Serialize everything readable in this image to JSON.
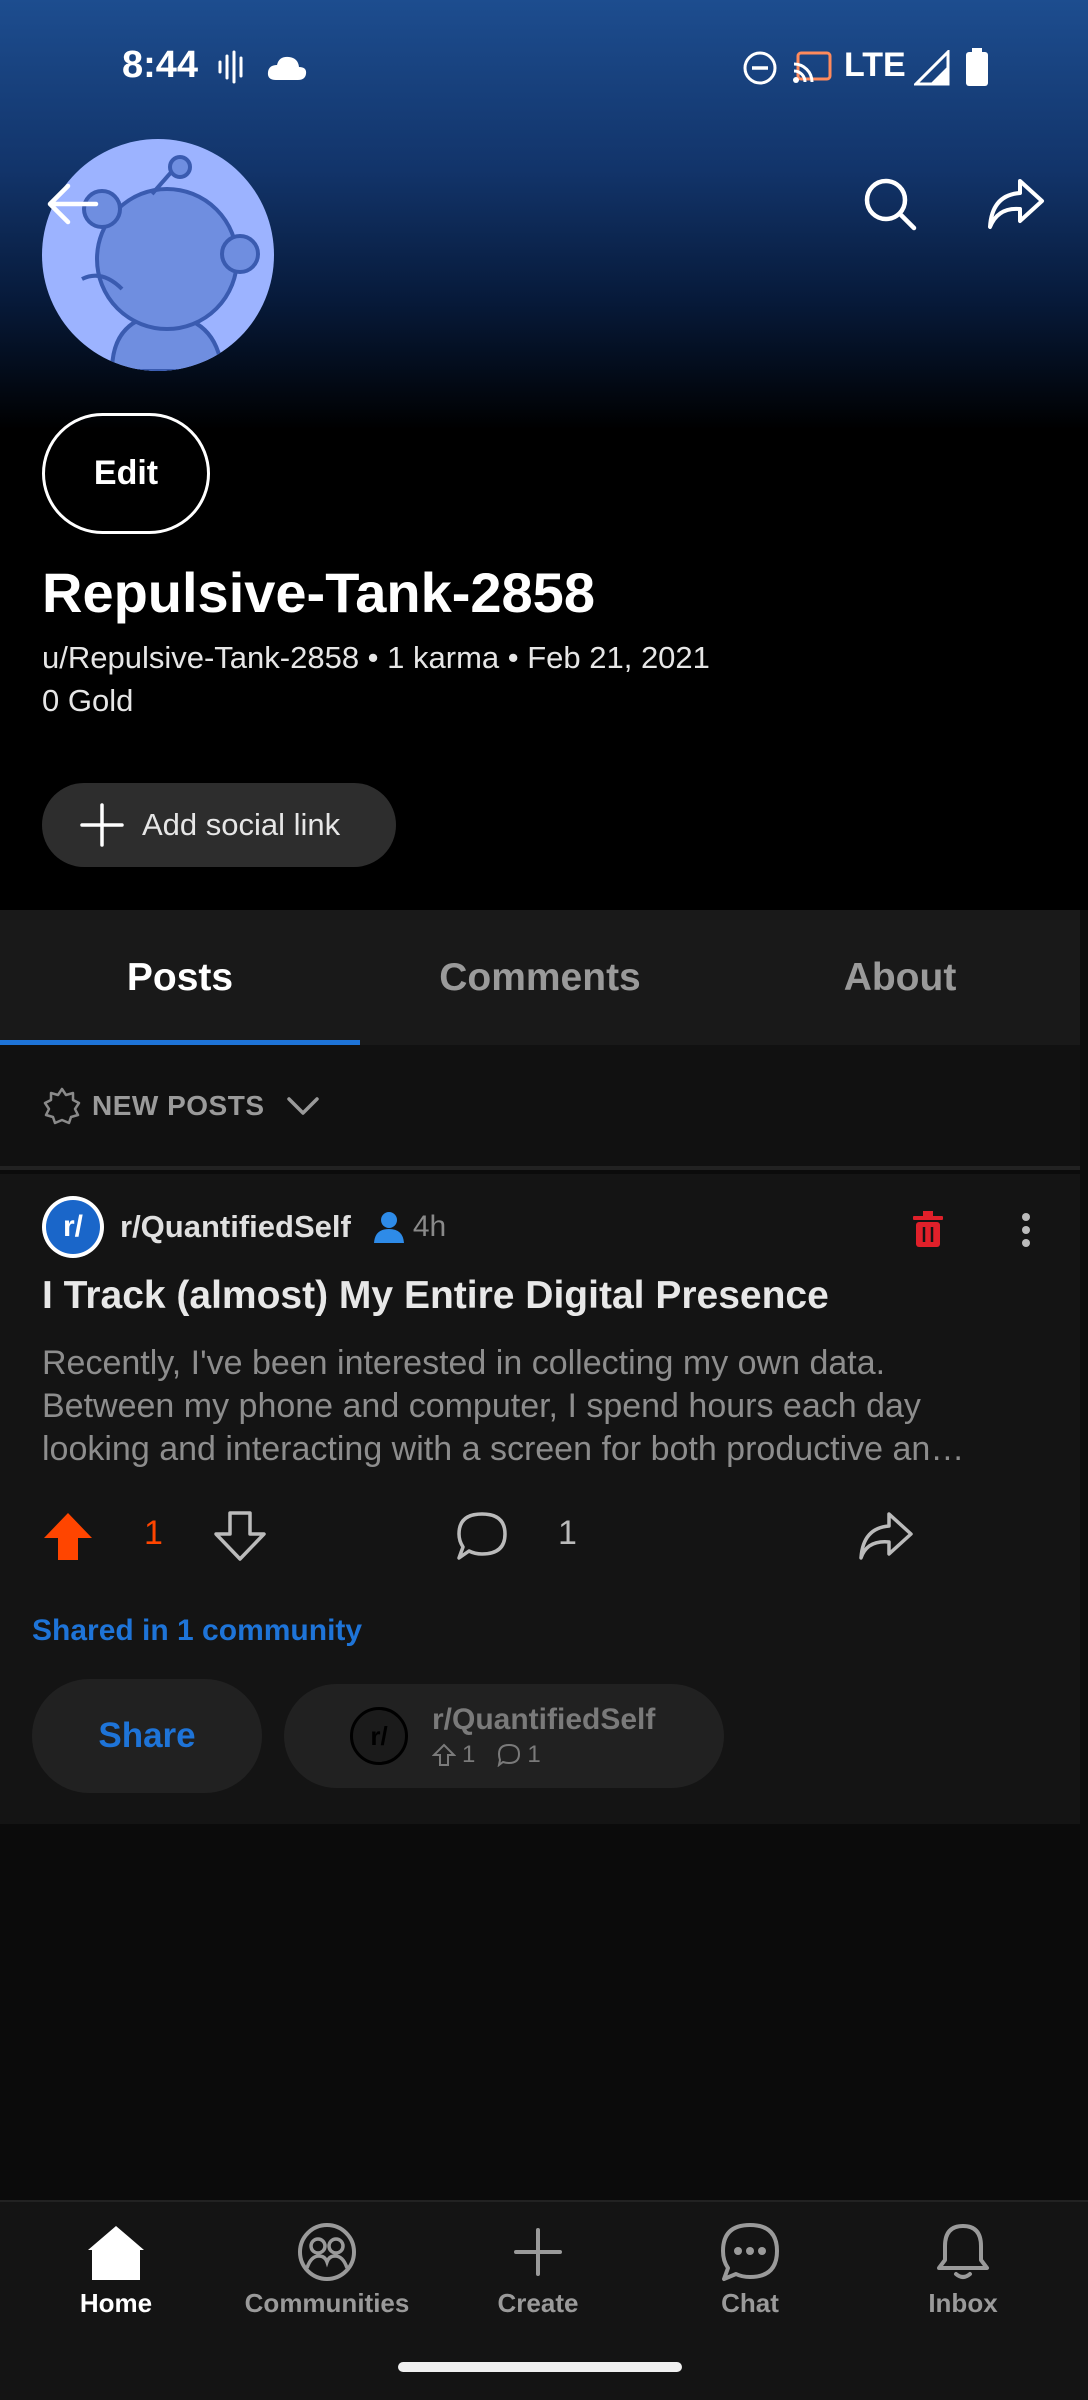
{
  "status_bar": {
    "time": "8:44",
    "network": "LTE",
    "icons": [
      "voicemail-icon",
      "cloud-icon",
      "dnd-icon",
      "cast-icon",
      "signal-icon",
      "battery-icon"
    ]
  },
  "profile": {
    "edit_label": "Edit",
    "display_name": "Repulsive-Tank-2858",
    "handle_line": "u/Repulsive-Tank-2858 • 1 karma • Feb 21, 2021",
    "gold_line": "0 Gold",
    "add_social_label": "Add social link"
  },
  "tabs": [
    {
      "label": "Posts",
      "active": true
    },
    {
      "label": "Comments",
      "active": false
    },
    {
      "label": "About",
      "active": false
    }
  ],
  "sort": {
    "label": "NEW POSTS"
  },
  "post": {
    "subreddit": "r/QuantifiedSelf",
    "subreddit_icon_text": "r/",
    "age": "4h",
    "title": "I Track (almost) My Entire Digital Presence",
    "body_lines": [
      "Recently, I've been interested in collecting my own data.",
      "Between my phone and computer, I spend hours each day",
      "looking and interacting with a screen for both productive an…"
    ],
    "upvotes": "1",
    "comments": "1",
    "shared_label": "Shared in 1 community",
    "share_label": "Share",
    "crosspost": {
      "name": "r/QuantifiedSelf",
      "upvotes": "1",
      "comments": "1"
    }
  },
  "bottom_nav": [
    {
      "label": "Home",
      "icon": "home-icon",
      "active": true
    },
    {
      "label": "Communities",
      "icon": "communities-icon",
      "active": false
    },
    {
      "label": "Create",
      "icon": "plus-icon",
      "active": false
    },
    {
      "label": "Chat",
      "icon": "chat-icon",
      "active": false
    },
    {
      "label": "Inbox",
      "icon": "bell-icon",
      "active": false
    }
  ],
  "colors": {
    "accent_blue": "#1e74d8",
    "upvote_orange": "#ff4500",
    "delete_red": "#e0202a",
    "avatar_bg": "#9cb3ff"
  }
}
